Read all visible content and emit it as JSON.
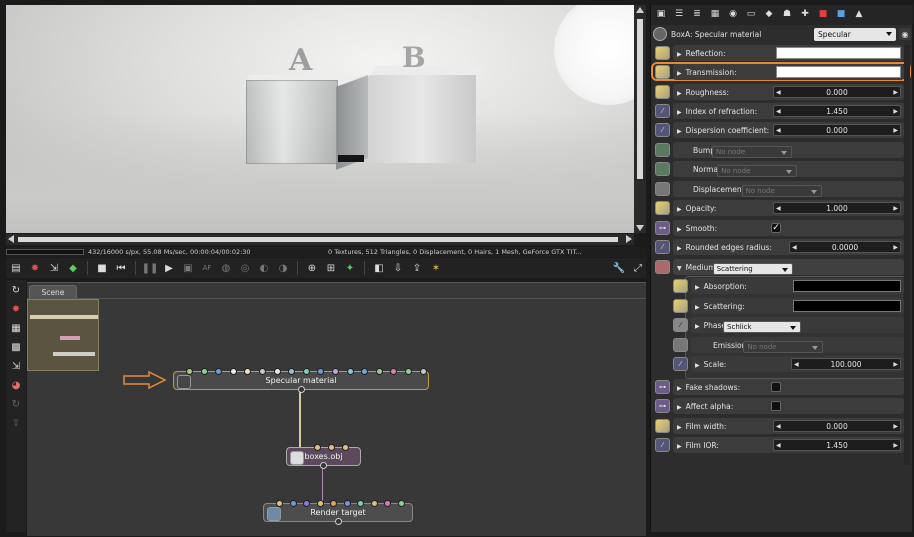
{
  "viewport": {
    "letters": [
      "A",
      "B"
    ]
  },
  "statusbar": {
    "left": "432/16000 s/px, 55.08 Ms/sec, 00:00:04/00:02:30",
    "right": "0 Textures, 512 Triangles, 0 Displacement, 0 Hairs, 1 Mesh, GeForce GTX TIT..."
  },
  "graph": {
    "tab": "Scene",
    "nodes": {
      "specular": "Specular material",
      "boxes": "boxes.obj",
      "render": "Render target"
    },
    "pin_colors": {
      "specular": [
        "#a9c77a",
        "#8fd18c",
        "#6b9ad8",
        "#e8e8e8",
        "#f2e6b0",
        "#c7c7c7",
        "#e8e8e8",
        "#8bc3dd",
        "#7ccfb0",
        "#6b9ad8",
        "#c9a0d8",
        "#8bc3dd",
        "#6fa8d8",
        "#8fd18c",
        "#e07ab0",
        "#8fd18c",
        "#c7c7c7"
      ],
      "boxes": [
        "#e0c080",
        "#e0c080",
        "#e0c080"
      ],
      "render": [
        "#e0c080",
        "#6b9ad8",
        "#8b79d8",
        "#e0c080",
        "#e0a060",
        "#6b9ad8",
        "#7ccfb0",
        "#d8c080",
        "#e070d0",
        "#8fd18c"
      ]
    }
  },
  "inspector": {
    "node_name": "BoxA: Specular material",
    "type": "Specular",
    "params": {
      "reflection": "Reflection:",
      "transmission": "Transmission:",
      "roughness": "Roughness:",
      "roughness_value": "0.000",
      "ior": "Index of refraction:",
      "ior_value": "1.450",
      "dispersion": "Dispersion coefficient:",
      "dispersion_value": "0.000",
      "bump": "Bump",
      "normal": "Normal",
      "displacement": "Displacement",
      "no_node": "No node",
      "opacity": "Opacity:",
      "opacity_value": "1.000",
      "smooth": "Smooth:",
      "rounded": "Rounded edges radius:",
      "rounded_value": "0.0000",
      "medium": "Medium",
      "medium_type": "Scattering",
      "absorption": "Absorption:",
      "scattering": "Scattering:",
      "phase": "Phase",
      "phase_value": "Schlick",
      "emission": "Emission",
      "scale": "Scale:",
      "scale_value": "100.000",
      "fake_shadows": "Fake shadows:",
      "affect_alpha": "Affect alpha:",
      "film_width": "Film width:",
      "film_width_value": "0.000",
      "film_ior": "Film IOR:",
      "film_ior_value": "1.450"
    }
  },
  "colors": {
    "highlight": "#e38a3a",
    "selected_node_border": "#c59a3a"
  }
}
